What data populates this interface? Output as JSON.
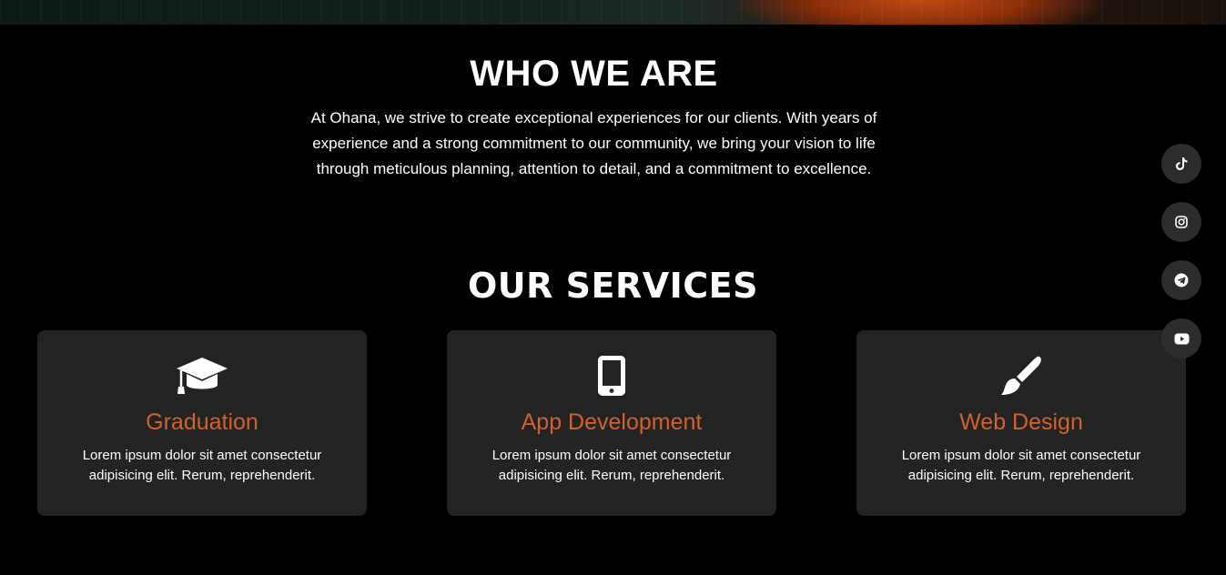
{
  "about": {
    "heading": "WHO WE ARE",
    "body": "At Ohana, we strive to create exceptional experiences for our clients. With years of experience and a strong commitment to our community, we bring your vision to life through meticulous planning, attention to detail, and a commitment to excellence."
  },
  "services": {
    "heading": "OUR SERVICES",
    "items": [
      {
        "icon": "graduation-cap-icon",
        "title": "Graduation",
        "description": "Lorem ipsum dolor sit amet consectetur adipisicing elit. Rerum, reprehenderit."
      },
      {
        "icon": "mobile-phone-icon",
        "title": "App Development",
        "description": "Lorem ipsum dolor sit amet consectetur adipisicing elit. Rerum, reprehenderit."
      },
      {
        "icon": "paintbrush-icon",
        "title": "Web Design",
        "description": "Lorem ipsum dolor sit amet consectetur adipisicing elit. Rerum, reprehenderit."
      }
    ]
  },
  "social": [
    {
      "icon": "tiktok-icon"
    },
    {
      "icon": "instagram-icon"
    },
    {
      "icon": "telegram-icon"
    },
    {
      "icon": "youtube-icon"
    }
  ],
  "colors": {
    "background": "#000000",
    "card": "#232323",
    "accent": "#d2622a",
    "social_button": "#2c2c2c"
  }
}
